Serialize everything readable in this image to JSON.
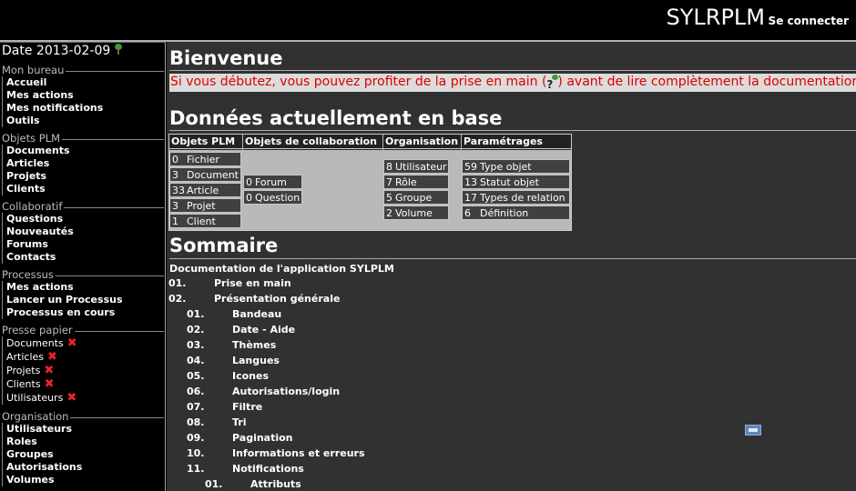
{
  "banner": {
    "title": "SYLRPLM",
    "login": "Se connecter"
  },
  "sidebar": {
    "date_label": "Date 2013-02-09",
    "groups": [
      {
        "title": "Mon bureau",
        "items": [
          "Accueil",
          "Mes actions",
          "Mes notifications",
          "Outils"
        ]
      },
      {
        "title": "Objets PLM",
        "items": [
          "Documents",
          "Articles",
          "Projets",
          "Clients"
        ]
      },
      {
        "title": "Collaboratif",
        "items": [
          "Questions",
          "Nouveautés",
          "Forums",
          "Contacts"
        ]
      },
      {
        "title": "Processus",
        "items": [
          "Mes actions",
          "Lancer un Processus",
          "Processus en cours"
        ]
      },
      {
        "title": "Presse papier",
        "items": [
          "Documents",
          "Articles",
          "Projets",
          "Clients",
          "Utilisateurs"
        ]
      },
      {
        "title": "Organisation",
        "items": [
          "Utilisateurs",
          "Roles",
          "Groupes",
          "Autorisations",
          "Volumes"
        ]
      }
    ]
  },
  "main": {
    "welcome_title": "Bienvenue",
    "intro_before": "Si vous débutez, vous pouvez profiter de la prise en main (",
    "intro_after": ") avant de lire complètement la documentation",
    "data_title": "Données actuellement en base",
    "stats": [
      {
        "header": "Objets PLM",
        "rows": [
          {
            "n": "0",
            "label": "Fichier"
          },
          {
            "n": "3",
            "label": "Document"
          },
          {
            "n": "33",
            "label": "Article"
          },
          {
            "n": "3",
            "label": "Projet"
          },
          {
            "n": "1",
            "label": "Client"
          }
        ]
      },
      {
        "header": "Objets de collaboration",
        "rows": [
          {
            "n": "0",
            "label": "Forum"
          },
          {
            "n": "0",
            "label": "Question"
          }
        ]
      },
      {
        "header": "Organisation",
        "rows": [
          {
            "n": "8",
            "label": "Utilisateur"
          },
          {
            "n": "7",
            "label": "Rôle"
          },
          {
            "n": "5",
            "label": "Groupe"
          },
          {
            "n": "2",
            "label": "Volume"
          }
        ]
      },
      {
        "header": "Paramétrages",
        "rows": [
          {
            "n": "59",
            "label": "Type objet"
          },
          {
            "n": "13",
            "label": "Statut objet"
          },
          {
            "n": "17",
            "label": "Types de relation"
          },
          {
            "n": "6",
            "label": "Définition"
          }
        ]
      }
    ],
    "summary_title": "Sommaire",
    "summary_subtitle": "Documentation de l'application SYLPLM",
    "toc": [
      {
        "num": "01.",
        "label": "Prise en main",
        "level": 0
      },
      {
        "num": "02.",
        "label": "Présentation générale",
        "level": 0
      },
      {
        "num": "01.",
        "label": "Bandeau",
        "level": 1
      },
      {
        "num": "02.",
        "label": "Date - Aide",
        "level": 1
      },
      {
        "num": "03.",
        "label": "Thèmes",
        "level": 1
      },
      {
        "num": "04.",
        "label": "Langues",
        "level": 1
      },
      {
        "num": "05.",
        "label": "Icones",
        "level": 1
      },
      {
        "num": "06.",
        "label": "Autorisations/login",
        "level": 1
      },
      {
        "num": "07.",
        "label": "Filtre",
        "level": 1
      },
      {
        "num": "08.",
        "label": "Tri",
        "level": 1
      },
      {
        "num": "09.",
        "label": "Pagination",
        "level": 1
      },
      {
        "num": "10.",
        "label": "Informations et erreurs",
        "level": 1
      },
      {
        "num": "11.",
        "label": "Notifications",
        "level": 1
      },
      {
        "num": "01.",
        "label": "Attributs",
        "level": 2
      }
    ]
  },
  "icons": {
    "help": "help-tree-icon",
    "remove": "red-x-icon",
    "float": "window-icon"
  },
  "colors": {
    "intro_text": "#dd0000",
    "remove_icon": "#ee2222"
  }
}
